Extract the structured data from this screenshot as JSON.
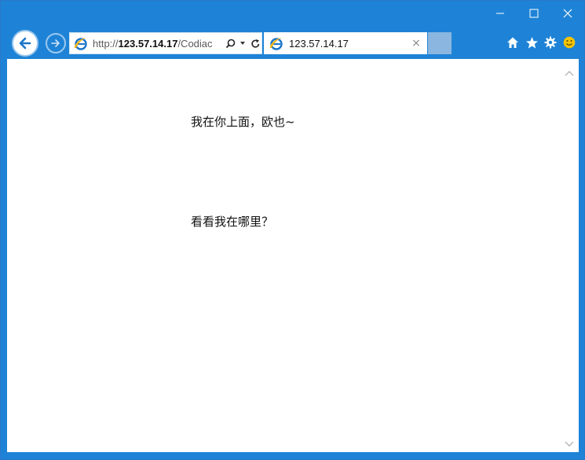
{
  "window": {
    "controls": [
      {
        "name": "minimize",
        "glyph": "—"
      },
      {
        "name": "maximize",
        "glyph": "☐"
      },
      {
        "name": "close",
        "glyph": "✕"
      }
    ]
  },
  "address_bar": {
    "scheme": "http://",
    "host": "123.57.14.17",
    "path": "/Codiac"
  },
  "tab": {
    "title": "123.57.14.17",
    "close_glyph": "×"
  },
  "page": {
    "line_1": "我在你上面，欧也~",
    "line_2": "看看我在哪里？"
  },
  "colors": {
    "chrome": "#1e83d6",
    "ie_blue": "#1b75c9",
    "smiley": "#f5c400"
  }
}
